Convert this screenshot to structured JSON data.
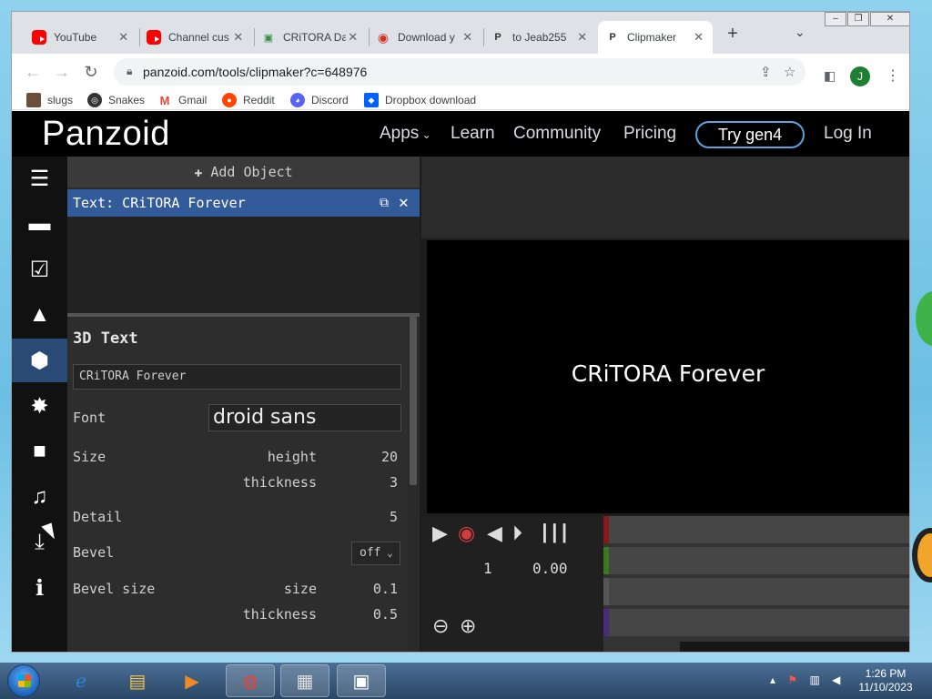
{
  "browser": {
    "tabs": [
      {
        "label": "YouTube",
        "icon": "youtube-icon"
      },
      {
        "label": "Channel cus",
        "icon": "youtube-icon"
      },
      {
        "label": "CRiTORA Da",
        "icon": "critora-icon"
      },
      {
        "label": "Download y",
        "icon": "download-site-icon"
      },
      {
        "label": "to Jeab255",
        "icon": "panzoid-icon"
      },
      {
        "label": "Clipmaker",
        "icon": "panzoid-icon",
        "active": true
      }
    ],
    "new_tab": "+",
    "url": "panzoid.com/tools/clipmaker?c=648976",
    "profile_initial": "J",
    "bookmarks": [
      {
        "label": "slugs",
        "color": "#6b4f3b"
      },
      {
        "label": "Snakes",
        "color": "#333333"
      },
      {
        "label": "Gmail",
        "color": "#ea4335"
      },
      {
        "label": "Reddit",
        "color": "#ff4500"
      },
      {
        "label": "Discord",
        "color": "#5865f2"
      },
      {
        "label": "Dropbox download",
        "color": "#0061ff"
      }
    ]
  },
  "panzoid": {
    "logo": "Panzoid",
    "nav": {
      "apps": "Apps",
      "learn": "Learn",
      "community": "Community",
      "pricing": "Pricing",
      "try": "Try gen4",
      "login": "Log In"
    },
    "add_object": "Add Object",
    "selected_object": "Text: CRiTORA Forever",
    "props": {
      "title": "3D Text",
      "text_value": "CRiTORA Forever",
      "font_label": "Font",
      "font_value": "droid sans",
      "size_label": "Size",
      "height_label": "height",
      "height_value": "20",
      "thickness_label": "thickness",
      "thickness_value": "3",
      "detail_label": "Detail",
      "detail_value": "5",
      "bevel_label": "Bevel",
      "bevel_value": "off",
      "bevel_size_label": "Bevel size",
      "bevel_size_sub": "size",
      "bevel_size_value": "0.1",
      "bevel_thickness_label": "thickness",
      "bevel_thickness_value": "0.5"
    },
    "preview_text": "CRiTORA Forever",
    "timeline": {
      "frame": "1",
      "time": "0.00"
    },
    "accent": "#335b99"
  },
  "taskbar": {
    "clock_time": "1:26 PM",
    "clock_date": "11/10/2023"
  }
}
